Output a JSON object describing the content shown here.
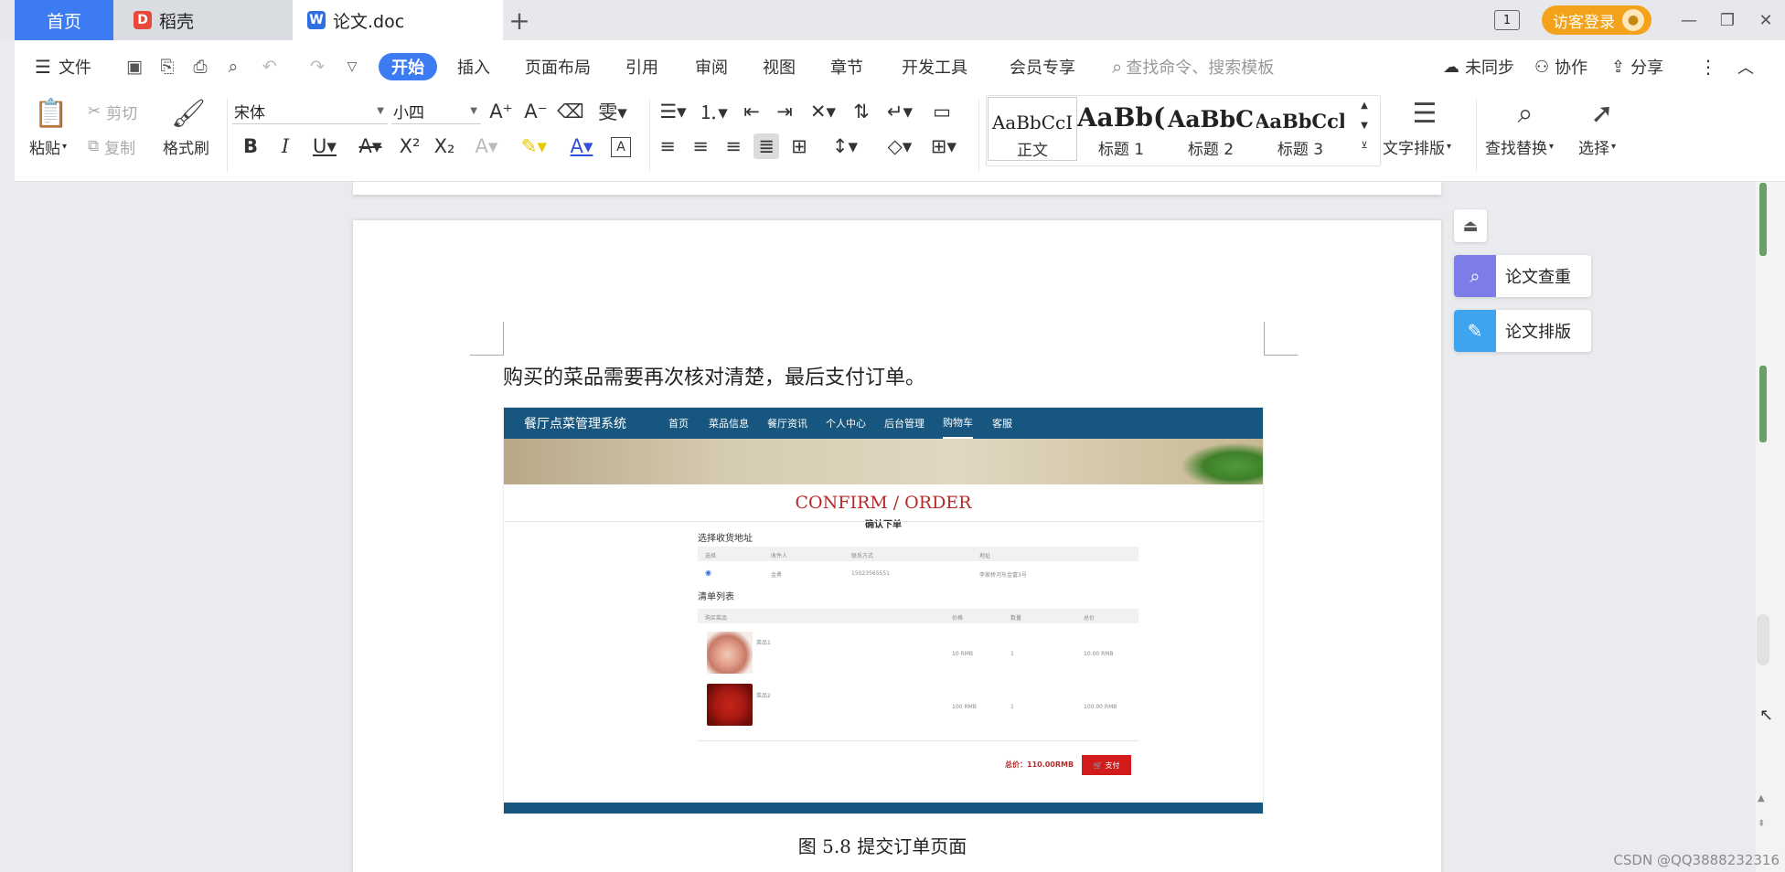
{
  "tabs": {
    "home": "首页",
    "daoke": "稻壳",
    "doc": "论文.doc"
  },
  "window": {
    "badge": "1",
    "login": "访客登录"
  },
  "menu": {
    "file": "文件",
    "items": [
      "开始",
      "插入",
      "页面布局",
      "引用",
      "审阅",
      "视图",
      "章节",
      "开发工具",
      "会员专享"
    ],
    "search_placeholder": "查找命令、搜索模板",
    "sync": "未同步",
    "collab": "协作",
    "share": "分享"
  },
  "ribbon": {
    "paste": "粘贴",
    "cut": "剪切",
    "copy": "复制",
    "format_painter": "格式刷",
    "font_name": "宋体",
    "font_size": "小四",
    "styles": [
      {
        "sample": "AaBbCcI",
        "name": "正文"
      },
      {
        "sample": "AaBb(",
        "name": "标题 1"
      },
      {
        "sample": "AaBbC",
        "name": "标题 2"
      },
      {
        "sample": "AaBbCcl",
        "name": "标题 3"
      }
    ],
    "text_layout": "文字排版",
    "find_replace": "查找替换",
    "select": "选择"
  },
  "document": {
    "body_text": "购买的菜品需要再次核对清楚，最后支付订单。",
    "caption": "图 5.8  提交订单页面"
  },
  "embedded": {
    "brand": "餐厅点菜管理系统",
    "nav": [
      "首页",
      "菜品信息",
      "餐厅资讯",
      "个人中心",
      "后台管理",
      "购物车",
      "客服"
    ],
    "title": "CONFIRM / ORDER",
    "subtitle": "确认下单",
    "address_heading": "选择收货地址",
    "address_cols": [
      "选择",
      "收件人",
      "联系方式",
      "地址"
    ],
    "address_row": [
      "金勇",
      "15023565551",
      "李家桥河东金富3号"
    ],
    "list_heading": "清单列表",
    "list_cols": [
      "购买菜品",
      "价格",
      "数量",
      "总价"
    ],
    "items": [
      {
        "name": "菜品1",
        "price": "10 RMB",
        "qty": "1",
        "total": "10.00 RMB"
      },
      {
        "name": "菜品2",
        "price": "100 RMB",
        "qty": "1",
        "total": "100.00 RMB"
      }
    ],
    "total": "总价：110.00RMB",
    "pay": "支付"
  },
  "side_panel": {
    "check": "论文查重",
    "layout": "论文排版"
  },
  "watermark": "CSDN @QQ3888232316"
}
